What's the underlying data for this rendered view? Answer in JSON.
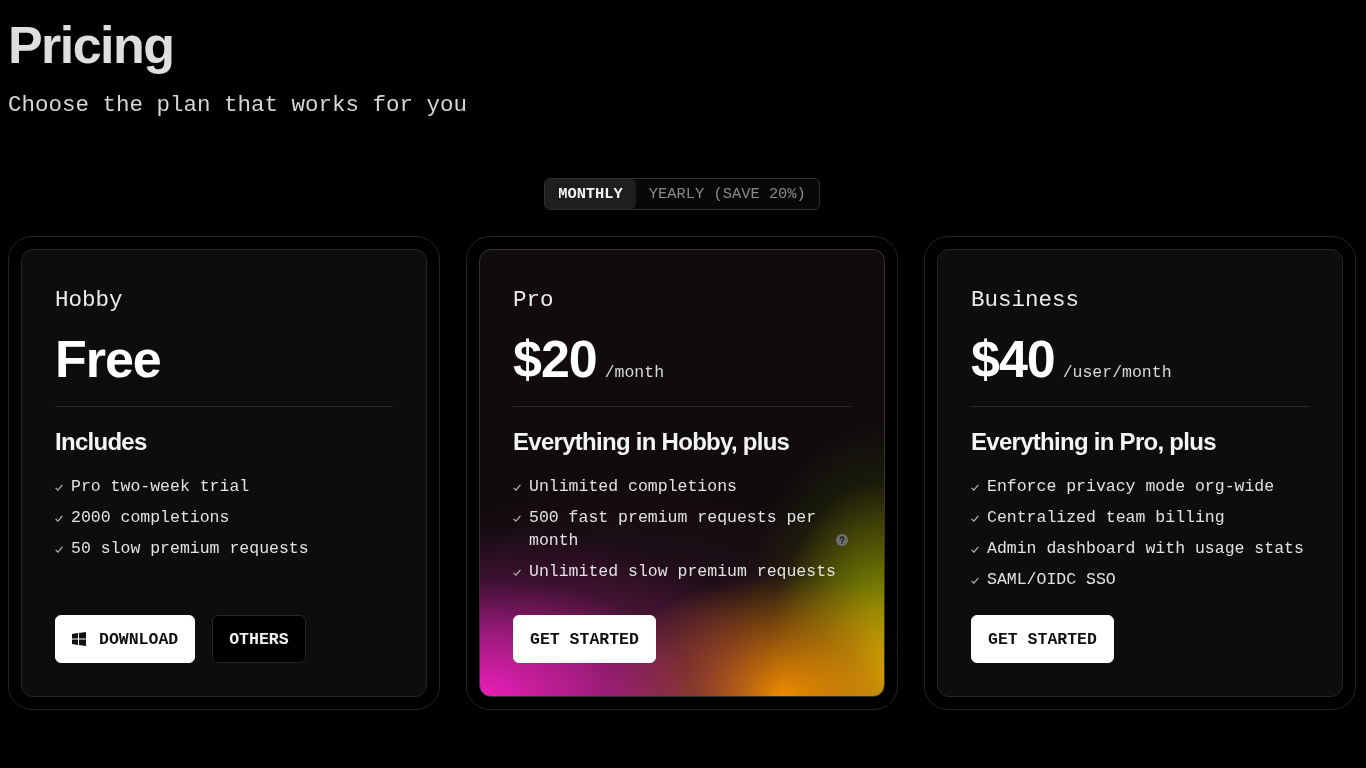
{
  "header": {
    "title": "Pricing",
    "subtitle": "Choose the plan that works for you"
  },
  "billing_toggle": [
    {
      "label": "MONTHLY",
      "selected": true
    },
    {
      "label": "YEARLY (SAVE 20%)",
      "selected": false
    }
  ],
  "plans": [
    {
      "name": "Hobby",
      "price": "Free",
      "highlighted": false,
      "features_heading": "Includes",
      "features": [
        {
          "text": "Pro two-week trial",
          "help": false
        },
        {
          "text": "2000 completions",
          "help": false
        },
        {
          "text": "50 slow premium requests",
          "help": false
        }
      ],
      "buttons": [
        {
          "label": "DOWNLOAD",
          "kind": "download"
        },
        {
          "label": "OTHERS",
          "kind": "outline"
        }
      ]
    },
    {
      "name": "Pro",
      "price": "$20",
      "period": "/month",
      "highlighted": true,
      "features_heading": "Everything in Hobby, plus",
      "features": [
        {
          "text": "Unlimited completions",
          "help": false
        },
        {
          "text": "500 fast premium requests per month",
          "help": true
        },
        {
          "text": "Unlimited slow premium requests",
          "help": false
        }
      ],
      "buttons": [
        {
          "label": "GET STARTED",
          "kind": "primary"
        }
      ]
    },
    {
      "name": "Business",
      "price": "$40",
      "period": "/user/month",
      "highlighted": false,
      "features_heading": "Everything in Pro, plus",
      "features": [
        {
          "text": "Enforce privacy mode org-wide",
          "help": false
        },
        {
          "text": "Centralized team billing",
          "help": false
        },
        {
          "text": "Admin dashboard with usage stats",
          "help": false
        },
        {
          "text": "SAML/OIDC SSO",
          "help": false
        }
      ],
      "buttons": [
        {
          "label": "GET STARTED",
          "kind": "primary"
        }
      ]
    }
  ]
}
